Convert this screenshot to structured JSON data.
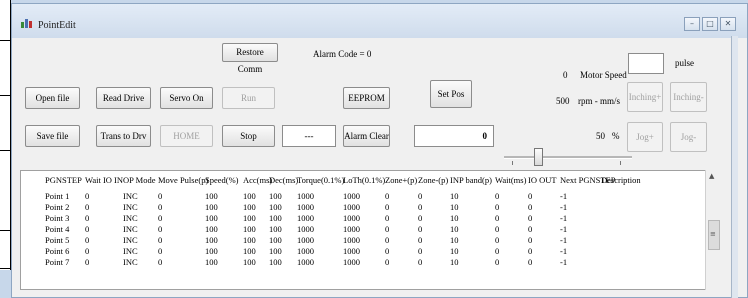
{
  "window": {
    "title": "PointEdit",
    "controls": {
      "minimize": "–",
      "maximize": "□",
      "close": "✕"
    }
  },
  "toolbar": {
    "restore_comm": "Restore Comm",
    "alarm_code": "Alarm Code = 0",
    "open_file": "Open file",
    "read_drive": "Read Drive",
    "servo_on": "Servo On",
    "run": "Run",
    "eeprom": "EEPROM",
    "set_pos": "Set Pos",
    "save_file": "Save file",
    "trans_to_drv": "Trans to Drv",
    "home": "HOME",
    "stop": "Stop",
    "status_display": "---",
    "alarm_clear": "Alarm Clear",
    "position_value": "0"
  },
  "motor": {
    "speed_value": "0",
    "speed_label": "Motor Speed",
    "pulse_unit": "pulse",
    "rpm_value": "500",
    "rpm_unit": "rpm - mm/s",
    "inching_pos": "Inching+",
    "inching_neg": "Inching-",
    "percent_value": "50",
    "percent_unit": "%",
    "jog_pos": "Jog+",
    "jog_neg": "Jog-",
    "slider_level_fraction": 0.24
  },
  "table": {
    "headers": [
      "PGNSTEP",
      "Wait IO IN",
      "OP Mode",
      "Move Pulse(p)",
      "Speed(%)",
      "Acc(ms)",
      "Dec(ms)",
      "Torque(0.1%)",
      "LoTh(0.1%)",
      "Zone+(p)",
      "Zone-(p)",
      "INP band(p)",
      "Wait(ms)",
      "IO OUT",
      "Next PGNSTEP",
      "Description"
    ],
    "rows": [
      [
        "Point 1",
        "0",
        "INC",
        "0",
        "100",
        "100",
        "100",
        "1000",
        "1000",
        "0",
        "0",
        "10",
        "0",
        "0",
        "-1",
        ""
      ],
      [
        "Point 2",
        "0",
        "INC",
        "0",
        "100",
        "100",
        "100",
        "1000",
        "1000",
        "0",
        "0",
        "10",
        "0",
        "0",
        "-1",
        ""
      ],
      [
        "Point 3",
        "0",
        "INC",
        "0",
        "100",
        "100",
        "100",
        "1000",
        "1000",
        "0",
        "0",
        "10",
        "0",
        "0",
        "-1",
        ""
      ],
      [
        "Point 4",
        "0",
        "INC",
        "0",
        "100",
        "100",
        "100",
        "1000",
        "1000",
        "0",
        "0",
        "10",
        "0",
        "0",
        "-1",
        ""
      ],
      [
        "Point 5",
        "0",
        "INC",
        "0",
        "100",
        "100",
        "100",
        "1000",
        "1000",
        "0",
        "0",
        "10",
        "0",
        "0",
        "-1",
        ""
      ],
      [
        "Point 6",
        "0",
        "INC",
        "0",
        "100",
        "100",
        "100",
        "1000",
        "1000",
        "0",
        "0",
        "10",
        "0",
        "0",
        "-1",
        ""
      ],
      [
        "Point 7",
        "0",
        "INC",
        "0",
        "100",
        "100",
        "100",
        "1000",
        "1000",
        "0",
        "0",
        "10",
        "0",
        "0",
        "-1",
        ""
      ]
    ]
  },
  "icons": {
    "app": "app-icon",
    "scroll_up": "▲",
    "scroll_down": "▼",
    "scroll_grip": "≡"
  }
}
